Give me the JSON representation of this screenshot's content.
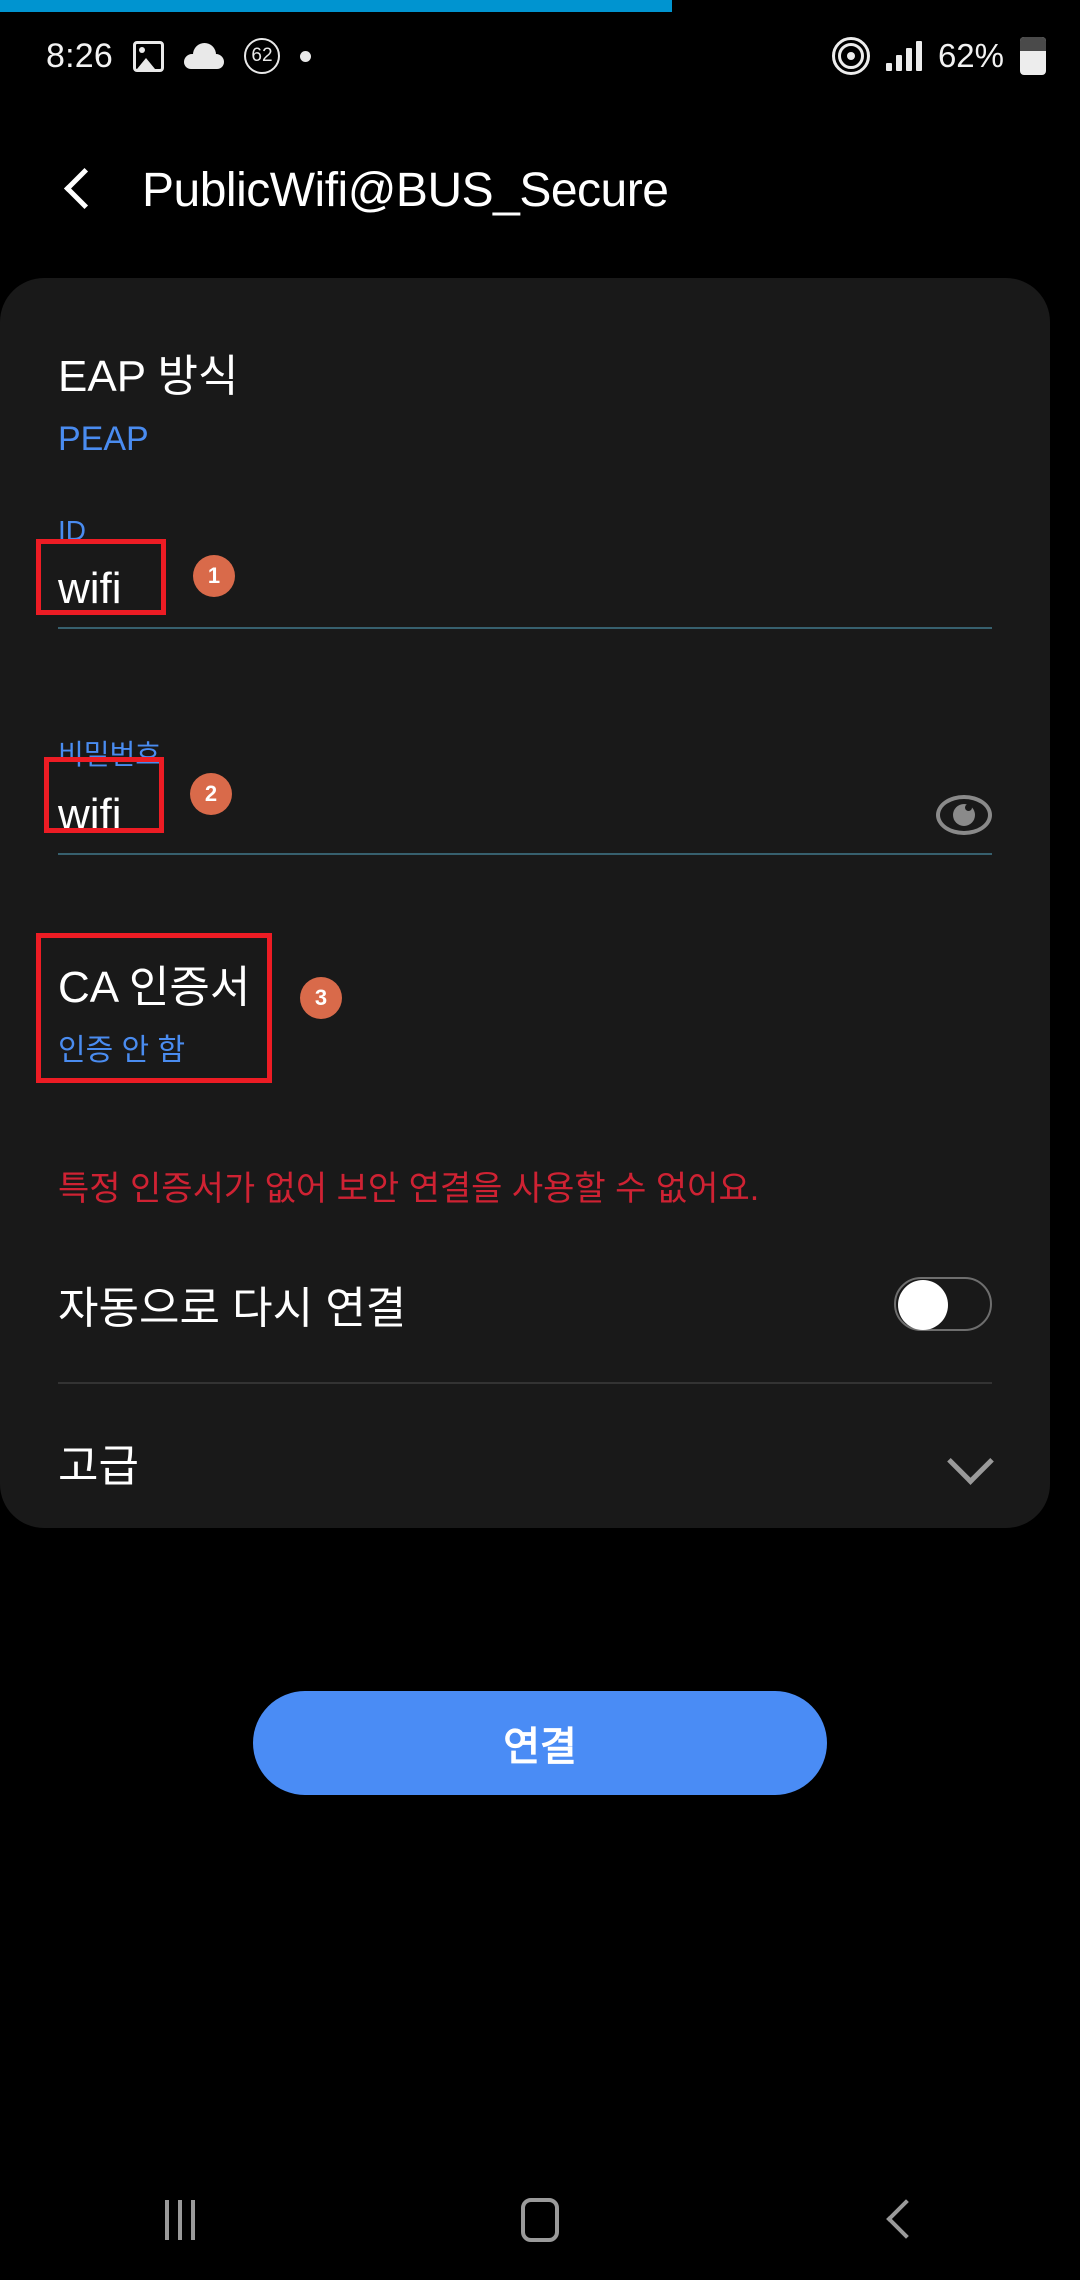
{
  "statusbar": {
    "time": "8:26",
    "image_icon": "image-icon",
    "cloud_icon": "cloud-icon",
    "badge_count": "62",
    "dot_icon": "dot-icon",
    "hotspot_icon": "hotspot-icon",
    "signal_icon": "signal-bars-icon",
    "battery_percent": "62%",
    "battery_icon": "battery-icon",
    "loading_color": "#0094d0"
  },
  "titlebar": {
    "back_icon": "chevron-left-icon",
    "title": "PublicWifi@BUS_Secure"
  },
  "form": {
    "eap": {
      "label": "EAP 방식",
      "value": "PEAP"
    },
    "identity": {
      "label": "ID",
      "value": "wifi",
      "annotation": "1"
    },
    "password": {
      "label": "비밀번호",
      "value": "wifi",
      "annotation": "2",
      "reveal_icon": "eye-icon"
    },
    "ca_cert": {
      "label": "CA 인증서",
      "value": "인증 안 함",
      "annotation": "3"
    },
    "warning": "특정 인증서가 없어 보안 연결을 사용할 수 없어요.",
    "auto_reconnect": {
      "label": "자동으로 다시 연결",
      "state": "off"
    },
    "advanced": {
      "label": "고급",
      "chevron_icon": "chevron-down-icon"
    }
  },
  "actions": {
    "connect_label": "연결",
    "connect_color": "#4a8cf5"
  },
  "navbar": {
    "recents_icon": "recents-icon",
    "home_icon": "home-icon",
    "back_icon": "back-icon"
  },
  "colors": {
    "accent_blue": "#4a8cf0",
    "warning_red": "#cf2233",
    "annotation_red": "#ed1c24",
    "annotation_badge": "#d96a4a",
    "card_bg": "#191919"
  }
}
